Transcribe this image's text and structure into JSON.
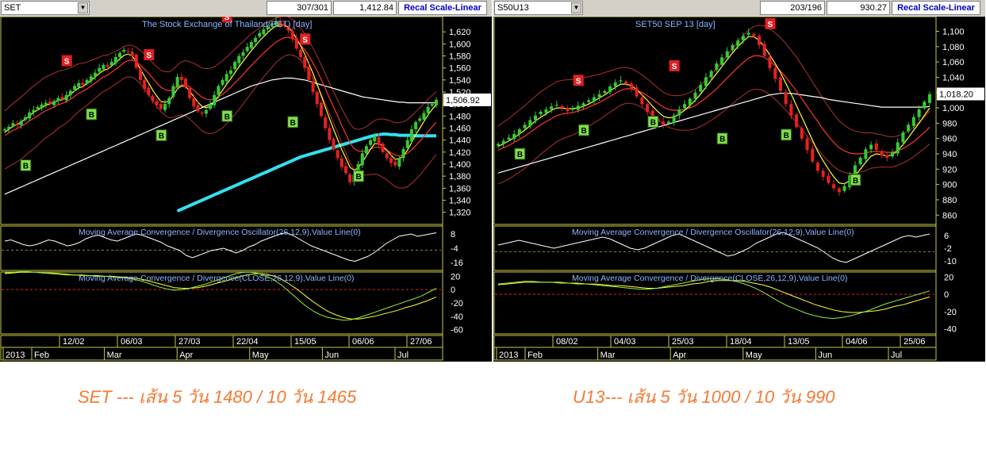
{
  "left": {
    "symbol": "SET",
    "volume_text": "307/301",
    "price_text": "1,412.84",
    "recal_label": "Recal Scale-Linear",
    "price_title": "The Stock Exchange of Thailand(SET)  [day]",
    "current_value_label": "1,506.92",
    "macd_title": "Moving Average Convergence / Divergence Oscillator(26,12,9),Value Line(0)",
    "macd2_title": "Moving Average Convergence / Divergence(CLOSE,26,12,9),Value Line(0)"
  },
  "right": {
    "symbol": "S50U13",
    "volume_text": "203/196",
    "price_text": "930.27",
    "recal_label": "Recal Scale-Linear",
    "price_title": "SET50 SEP 13   [day]",
    "current_value_label": "1,018.20",
    "macd_title": "Moving Average Convergence / Divergence Oscillator(26,12,9),Value Line(0)",
    "macd2_title": "Moving Average Convergence / Divergence(CLOSE,26,12,9),Value Line(0)"
  },
  "captions": {
    "left": "SET --- เส้น 5 วัน 1480 / 10 วัน 1465",
    "right": "U13--- เส้น 5 วัน 1000 / 10 วัน 990"
  },
  "icons": {
    "dropdown": "chevron-down-icon"
  },
  "colors": {
    "background": "#000000",
    "up_candle": "#33cc33",
    "down_candle": "#e82020",
    "ema_short": "#ffff33",
    "ema_mid": "#ff3333",
    "ma_long": "#ffffff",
    "ma_200": "#33e0f0",
    "bollinger": "#b03030",
    "grid": "#777733",
    "axis_text": "#ffffff",
    "title_text": "#8ab4ff",
    "buy_box": "#7fe04a",
    "sell_box": "#e02020",
    "caption": "#f47a35"
  },
  "chart_data": [
    {
      "type": "candlestick",
      "title": "The Stock Exchange of Thailand(SET)  [day]",
      "yticks": [
        1320,
        1340,
        1360,
        1380,
        1400,
        1420,
        1440,
        1460,
        1480,
        1500,
        1520,
        1540,
        1560,
        1580,
        1600,
        1620
      ],
      "ylim": [
        1305,
        1640
      ],
      "last_value": 1506.92,
      "date_ticks": [
        "12/02",
        "06/03",
        "27/03",
        "22/04",
        "15/05",
        "06/06",
        "27/06"
      ],
      "month_ticks": [
        "2013",
        "Feb",
        "Mar",
        "Apr",
        "May",
        "Jun",
        "Jul"
      ],
      "close": [
        1458,
        1462,
        1468,
        1465,
        1472,
        1478,
        1486,
        1490,
        1495,
        1499,
        1502,
        1500,
        1505,
        1510,
        1508,
        1515,
        1522,
        1530,
        1535,
        1532,
        1540,
        1546,
        1552,
        1560,
        1565,
        1562,
        1570,
        1578,
        1585,
        1590,
        1587,
        1580,
        1560,
        1540,
        1525,
        1515,
        1505,
        1498,
        1492,
        1500,
        1510,
        1530,
        1545,
        1540,
        1528,
        1510,
        1496,
        1488,
        1484,
        1490,
        1500,
        1515,
        1530,
        1540,
        1550,
        1556,
        1570,
        1580,
        1586,
        1595,
        1603,
        1610,
        1618,
        1624,
        1628,
        1634,
        1638,
        1632,
        1630,
        1622,
        1608,
        1592,
        1578,
        1560,
        1540,
        1520,
        1500,
        1480,
        1460,
        1440,
        1425,
        1410,
        1395,
        1385,
        1370,
        1382,
        1400,
        1418,
        1430,
        1440,
        1445,
        1432,
        1420,
        1410,
        1402,
        1398,
        1410,
        1425,
        1440,
        1458,
        1470,
        1476,
        1485,
        1495,
        1500,
        1507
      ],
      "buy_signals": [
        1398,
        1483,
        1448,
        1480,
        1470,
        1380
      ],
      "sell_signals": [
        1572,
        1582,
        1645,
        1608
      ],
      "ema_short": [
        1453,
        1458,
        1463,
        1466,
        1470,
        1475,
        1480,
        1486,
        1490,
        1494,
        1498,
        1500,
        1503,
        1506,
        1507,
        1511,
        1516,
        1522,
        1527,
        1529,
        1534,
        1539,
        1545,
        1551,
        1556,
        1558,
        1563,
        1569,
        1575,
        1581,
        1583,
        1580,
        1570,
        1558,
        1546,
        1535,
        1523,
        1513,
        1504,
        1503,
        1505,
        1514,
        1525,
        1530,
        1529,
        1522,
        1512,
        1503,
        1496,
        1494,
        1496,
        1503,
        1513,
        1523,
        1533,
        1542,
        1552,
        1562,
        1571,
        1580,
        1589,
        1597,
        1605,
        1612,
        1619,
        1625,
        1630,
        1631,
        1631,
        1628,
        1620,
        1609,
        1597,
        1583,
        1567,
        1551,
        1533,
        1514,
        1495,
        1476,
        1458,
        1441,
        1424,
        1410,
        1395,
        1390,
        1394,
        1403,
        1414,
        1425,
        1434,
        1434,
        1430,
        1423,
        1415,
        1408,
        1409,
        1414,
        1423,
        1436,
        1449,
        1460,
        1471,
        1482,
        1491,
        1499
      ],
      "ema_mid": [
        1448,
        1452,
        1456,
        1459,
        1463,
        1467,
        1472,
        1476,
        1480,
        1485,
        1489,
        1492,
        1495,
        1499,
        1501,
        1504,
        1508,
        1513,
        1518,
        1521,
        1525,
        1530,
        1535,
        1540,
        1545,
        1548,
        1553,
        1558,
        1563,
        1569,
        1572,
        1573,
        1570,
        1565,
        1558,
        1551,
        1543,
        1535,
        1528,
        1524,
        1522,
        1524,
        1529,
        1532,
        1532,
        1528,
        1523,
        1517,
        1511,
        1508,
        1507,
        1508,
        1512,
        1516,
        1522,
        1528,
        1535,
        1542,
        1549,
        1557,
        1564,
        1571,
        1578,
        1585,
        1591,
        1597,
        1603,
        1607,
        1610,
        1611,
        1609,
        1605,
        1598,
        1590,
        1580,
        1568,
        1555,
        1541,
        1526,
        1510,
        1495,
        1480,
        1464,
        1450,
        1435,
        1426,
        1422,
        1421,
        1422,
        1425,
        1428,
        1428,
        1426,
        1423,
        1419,
        1415,
        1414,
        1415,
        1418,
        1424,
        1431,
        1438,
        1446,
        1454,
        1462,
        1470
      ],
      "ma_long": [
        1350,
        1353,
        1356,
        1359,
        1362,
        1365,
        1368,
        1371,
        1374,
        1377,
        1380,
        1383,
        1386,
        1389,
        1392,
        1395,
        1398,
        1401,
        1404,
        1407,
        1410,
        1413,
        1416,
        1419,
        1422,
        1425,
        1428,
        1431,
        1434,
        1437,
        1440,
        1443,
        1446,
        1449,
        1452,
        1455,
        1458,
        1461,
        1464,
        1467,
        1470,
        1473,
        1476,
        1479,
        1482,
        1485,
        1488,
        1491,
        1494,
        1497,
        1500,
        1503,
        1506,
        1509,
        1512,
        1515,
        1518,
        1521,
        1524,
        1527,
        1530,
        1532,
        1534,
        1536,
        1538,
        1540,
        1541,
        1542,
        1543,
        1543,
        1543,
        1542,
        1541,
        1540,
        1538,
        1536,
        1534,
        1532,
        1530,
        1528,
        1526,
        1524,
        1522,
        1520,
        1518,
        1516,
        1514,
        1512,
        1511,
        1510,
        1509,
        1508,
        1507,
        1506,
        1505,
        1504,
        1503,
        1503,
        1502,
        1502,
        1502,
        1502,
        1502,
        1502,
        1502,
        1502
      ],
      "ma_200": [
        1322,
        1325,
        1328,
        1331,
        1334,
        1337,
        1340,
        1343,
        1346,
        1349,
        1352,
        1355,
        1358,
        1361,
        1364,
        1367,
        1370,
        1373,
        1376,
        1379,
        1382,
        1385,
        1388,
        1391,
        1394,
        1397,
        1400,
        1403,
        1406,
        1409,
        1412,
        1414,
        1416,
        1418,
        1420,
        1422,
        1424,
        1426,
        1428,
        1430,
        1432,
        1434,
        1436,
        1438,
        1440,
        1442,
        1444,
        1446,
        1448,
        1449,
        1450,
        1450,
        1449,
        1449,
        1448,
        1448,
        1448,
        1448,
        1447,
        1447,
        1447,
        1447,
        1447,
        1447
      ],
      "macd_osc": [
        2,
        3,
        1,
        -1,
        -2,
        -1,
        1,
        3,
        2,
        0,
        -2,
        -1,
        1,
        4,
        6,
        7,
        5,
        3,
        2,
        4,
        6,
        8,
        7,
        5,
        3,
        1,
        -2,
        -4,
        -6,
        -10,
        -12,
        -10,
        -8,
        -6,
        -5,
        -4,
        -6,
        -8,
        -6,
        -3,
        -1,
        2,
        4,
        6,
        8,
        9,
        7,
        4,
        1,
        -2,
        -4,
        -6,
        -8,
        -10,
        -12,
        -14,
        -15,
        -13,
        -11,
        -8,
        -4,
        0,
        3,
        6,
        7,
        8,
        6,
        7,
        8,
        9
      ],
      "macd_line": [
        25,
        26,
        27,
        27,
        26,
        25,
        24,
        23,
        22,
        22,
        21,
        21,
        20,
        20,
        19,
        18,
        17,
        15,
        12,
        8,
        4,
        1,
        -1,
        0,
        2,
        5,
        8,
        12,
        16,
        20,
        24,
        26,
        26,
        24,
        20,
        14,
        6,
        -4,
        -14,
        -24,
        -32,
        -38,
        -42,
        -44,
        -46,
        -45,
        -42,
        -38,
        -34,
        -30,
        -26,
        -22,
        -18,
        -14,
        -10,
        -4,
        2
      ],
      "signal_line": [
        24,
        25,
        26,
        26,
        26,
        25,
        25,
        24,
        23,
        22,
        22,
        21,
        21,
        20,
        20,
        19,
        18,
        17,
        15,
        12,
        9,
        6,
        3,
        2,
        2,
        3,
        5,
        8,
        11,
        14,
        18,
        21,
        23,
        24,
        23,
        20,
        15,
        8,
        0,
        -9,
        -18,
        -26,
        -33,
        -38,
        -42,
        -44,
        -44,
        -42,
        -40,
        -37,
        -34,
        -31,
        -27,
        -24,
        -20,
        -16,
        -11
      ],
      "macd_osc_yticks": [
        8,
        -4,
        -16
      ],
      "macd_yticks": [
        20,
        0,
        -20,
        -40,
        -60
      ]
    },
    {
      "type": "candlestick",
      "title": "SET50 SEP 13   [day]",
      "yticks": [
        860,
        880,
        900,
        920,
        940,
        960,
        980,
        1000,
        1020,
        1040,
        1060,
        1080,
        1100
      ],
      "ylim": [
        852,
        1115
      ],
      "last_value": 1018.2,
      "date_ticks": [
        "08/02",
        "04/03",
        "25/03",
        "18/04",
        "13/05",
        "04/06",
        "25/06"
      ],
      "month_ticks": [
        "2013",
        "Feb",
        "Mar",
        "Apr",
        "May",
        "Jun",
        "Jul"
      ],
      "close": [
        953,
        957,
        961,
        966,
        972,
        978,
        984,
        990,
        995,
        998,
        1002,
        1004,
        1000,
        996,
        999,
        1003,
        1006,
        1010,
        1014,
        1018,
        1022,
        1028,
        1033,
        1036,
        1032,
        1025,
        1015,
        1005,
        995,
        988,
        982,
        978,
        982,
        990,
        998,
        1005,
        1012,
        1020,
        1030,
        1040,
        1048,
        1058,
        1066,
        1074,
        1082,
        1088,
        1094,
        1098,
        1094,
        1082,
        1068,
        1052,
        1038,
        1022,
        1005,
        990,
        975,
        960,
        945,
        930,
        918,
        910,
        902,
        895,
        890,
        898,
        912,
        925,
        935,
        946,
        952,
        945,
        938,
        935,
        942,
        955,
        968,
        978,
        988,
        998,
        1008,
        1018
      ],
      "buy_signals": [
        940,
        971,
        982,
        960,
        965,
        906
      ],
      "sell_signals": [
        1036,
        1055,
        1110
      ],
      "ema_short": [
        950,
        953,
        957,
        961,
        966,
        971,
        977,
        983,
        988,
        992,
        997,
        1000,
        1000,
        999,
        999,
        1000,
        1002,
        1005,
        1009,
        1013,
        1017,
        1022,
        1027,
        1031,
        1031,
        1029,
        1024,
        1017,
        1010,
        1002,
        995,
        989,
        987,
        988,
        992,
        997,
        1003,
        1010,
        1018,
        1027,
        1036,
        1045,
        1054,
        1063,
        1072,
        1080,
        1087,
        1093,
        1093,
        1088,
        1080,
        1069,
        1058,
        1046,
        1032,
        1018,
        1003,
        988,
        973,
        958,
        943,
        931,
        920,
        910,
        902,
        901,
        905,
        912,
        920,
        929,
        937,
        940,
        939,
        937,
        939,
        944,
        952,
        961,
        971,
        980,
        990,
        1000
      ],
      "ema_mid": [
        945,
        948,
        951,
        955,
        959,
        963,
        968,
        973,
        978,
        982,
        986,
        990,
        992,
        993,
        994,
        996,
        998,
        1001,
        1004,
        1007,
        1011,
        1015,
        1019,
        1023,
        1025,
        1025,
        1023,
        1020,
        1016,
        1011,
        1006,
        1001,
        998,
        997,
        997,
        998,
        1000,
        1003,
        1008,
        1013,
        1019,
        1025,
        1032,
        1039,
        1046,
        1053,
        1059,
        1065,
        1068,
        1068,
        1066,
        1061,
        1055,
        1048,
        1040,
        1031,
        1022,
        1012,
        1002,
        992,
        982,
        972,
        963,
        955,
        948,
        944,
        941,
        940,
        940,
        941,
        943,
        943,
        943,
        942,
        942,
        944,
        947,
        951,
        956,
        962,
        968,
        975
      ],
      "ma_long": [
        915,
        917,
        919,
        921,
        923,
        925,
        927,
        929,
        931,
        933,
        935,
        937,
        939,
        941,
        943,
        945,
        947,
        949,
        951,
        953,
        955,
        957,
        959,
        961,
        963,
        965,
        967,
        969,
        971,
        973,
        975,
        977,
        979,
        981,
        983,
        985,
        987,
        989,
        991,
        993,
        995,
        997,
        999,
        1001,
        1003,
        1005,
        1007,
        1009,
        1011,
        1013,
        1015,
        1017,
        1018,
        1019,
        1019,
        1019,
        1018,
        1017,
        1016,
        1015,
        1014,
        1013,
        1011,
        1010,
        1009,
        1008,
        1007,
        1006,
        1005,
        1004,
        1003,
        1002,
        1001,
        1001,
        1001,
        1001,
        1001,
        1001,
        1001,
        1001,
        1001,
        1002
      ],
      "macd_osc": [
        0,
        1,
        2,
        3,
        2,
        1,
        0,
        -1,
        -2,
        -1,
        0,
        1,
        2,
        3,
        4,
        5,
        4,
        2,
        0,
        -2,
        -3,
        -2,
        0,
        2,
        4,
        6,
        7,
        5,
        3,
        1,
        -1,
        -3,
        -5,
        -7,
        -6,
        -4,
        -2,
        1,
        3,
        5,
        7,
        8,
        6,
        4,
        2,
        0,
        -2,
        -5,
        -8,
        -10,
        -11,
        -9,
        -7,
        -5,
        -3,
        -1,
        1,
        3,
        5,
        6,
        5,
        6,
        7
      ],
      "macd_line": [
        12,
        13,
        14,
        15,
        15,
        14,
        14,
        13,
        13,
        12,
        12,
        11,
        10,
        9,
        8,
        7,
        6,
        6,
        7,
        9,
        11,
        13,
        15,
        17,
        18,
        18,
        17,
        15,
        12,
        8,
        3,
        -3,
        -9,
        -14,
        -18,
        -22,
        -25,
        -27,
        -28,
        -27,
        -25,
        -22,
        -19,
        -15,
        -11,
        -8,
        -5,
        -2,
        1,
        4
      ],
      "signal_line": [
        11,
        12,
        13,
        14,
        14,
        14,
        14,
        14,
        13,
        13,
        12,
        12,
        11,
        10,
        10,
        9,
        8,
        7,
        7,
        8,
        9,
        10,
        12,
        13,
        15,
        16,
        16,
        16,
        15,
        13,
        11,
        8,
        4,
        0,
        -4,
        -8,
        -12,
        -15,
        -18,
        -20,
        -21,
        -21,
        -20,
        -19,
        -17,
        -14,
        -12,
        -9,
        -6,
        -3
      ],
      "macd_osc_yticks": [
        6,
        -2,
        -10
      ],
      "macd_yticks": [
        20,
        0,
        -20,
        -40
      ]
    }
  ]
}
